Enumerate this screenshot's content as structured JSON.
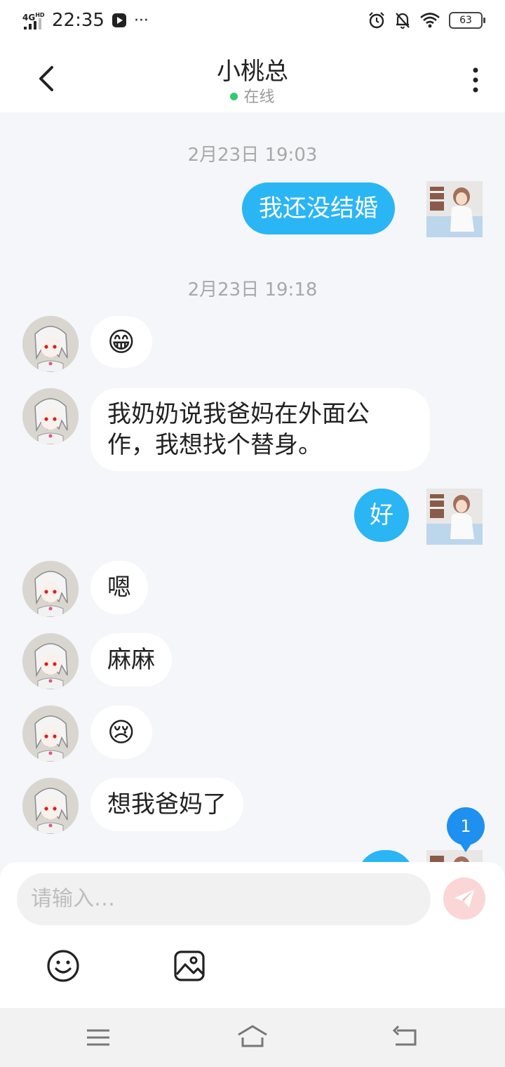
{
  "status_bar": {
    "network": "4G",
    "network_hd": "HD",
    "time": "22:35",
    "more": "···",
    "battery": "63"
  },
  "header": {
    "title": "小桃总",
    "status": "在线",
    "status_color": "#2ecc71"
  },
  "messages": [
    {
      "type": "timestamp",
      "text": "2月23日 19:03"
    },
    {
      "type": "out",
      "text": "我还没结婚"
    },
    {
      "type": "timestamp",
      "text": "2月23日 19:18"
    },
    {
      "type": "in",
      "text": "😁"
    },
    {
      "type": "in",
      "line1": "我奶奶说我爸妈在外面公",
      "line2": "作，我想找个替身。"
    },
    {
      "type": "out",
      "text": "好"
    },
    {
      "type": "in",
      "text": "嗯"
    },
    {
      "type": "in",
      "text": "麻麻"
    },
    {
      "type": "in",
      "text": "😢"
    },
    {
      "type": "in",
      "text": "想我爸妈了"
    }
  ],
  "unread_badge": "1",
  "composer": {
    "placeholder": "请输入…",
    "icons": [
      "smiley-icon",
      "image-icon",
      "send-icon"
    ]
  },
  "colors": {
    "outgoing_bubble": "#2ab5f5",
    "incoming_bubble": "#ffffff",
    "chat_background": "#f4f6f9",
    "badge": "#1e90ef"
  }
}
